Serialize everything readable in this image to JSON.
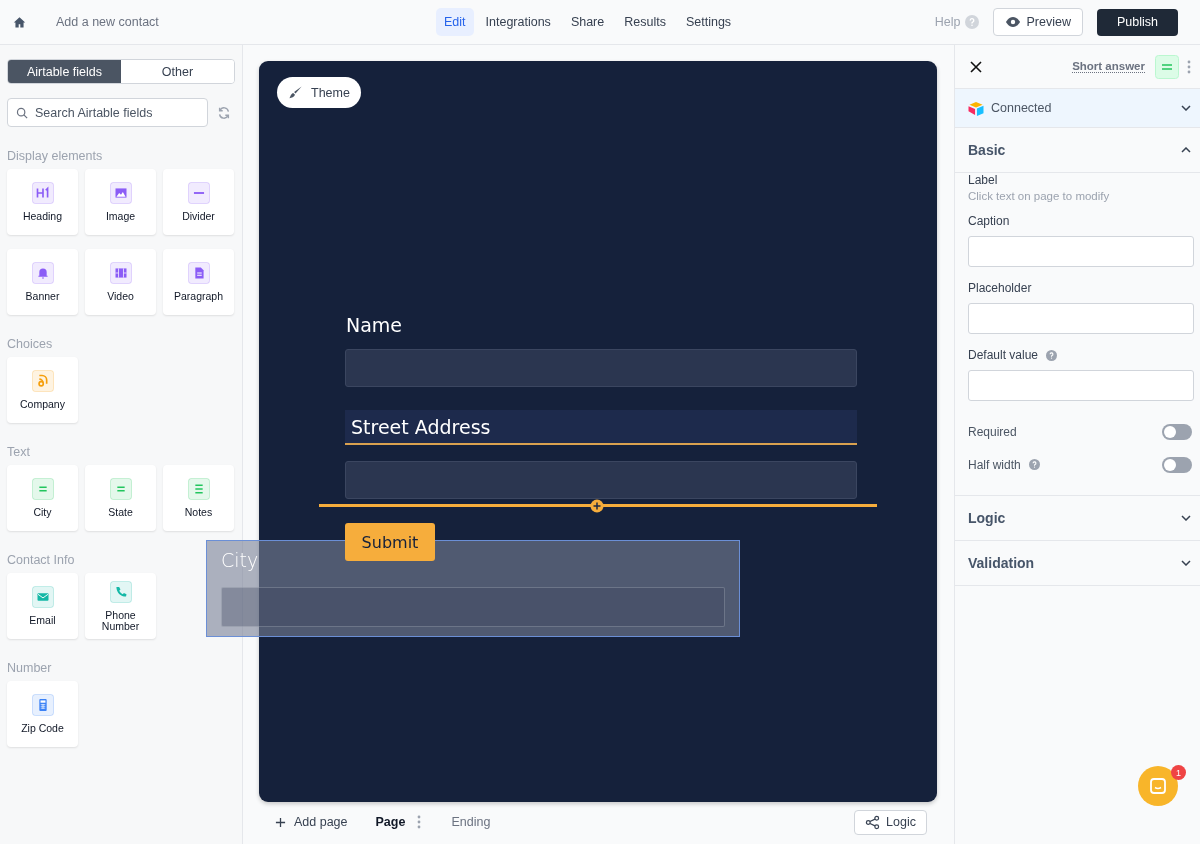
{
  "topbar": {
    "title": "Add a new contact",
    "tabs": [
      {
        "label": "Edit",
        "selected": true
      },
      {
        "label": "Integrations",
        "selected": false
      },
      {
        "label": "Share",
        "selected": false
      },
      {
        "label": "Results",
        "selected": false
      },
      {
        "label": "Settings",
        "selected": false
      }
    ],
    "help": "Help",
    "preview": "Preview",
    "publish": "Publish"
  },
  "sidebar": {
    "source_tabs": [
      {
        "label": "Airtable fields",
        "selected": true
      },
      {
        "label": "Other",
        "selected": false
      }
    ],
    "search": {
      "placeholder": "Search Airtable fields"
    },
    "groups": [
      {
        "title": "Display elements",
        "items": [
          {
            "label": "Heading",
            "kind": "heading",
            "color": "#8b5cf6"
          },
          {
            "label": "Image",
            "kind": "image",
            "color": "#8b5cf6"
          },
          {
            "label": "Divider",
            "kind": "divider",
            "color": "#8b5cf6"
          },
          {
            "label": "Banner",
            "kind": "banner",
            "color": "#8b5cf6"
          },
          {
            "label": "Video",
            "kind": "video",
            "color": "#8b5cf6"
          },
          {
            "label": "Paragraph",
            "kind": "paragraph",
            "color": "#8b5cf6"
          }
        ]
      },
      {
        "title": "Choices",
        "items": [
          {
            "label": "Company",
            "kind": "choice",
            "color": "#f59e0b"
          }
        ]
      },
      {
        "title": "Text",
        "items": [
          {
            "label": "City",
            "kind": "short",
            "color": "#22c55e"
          },
          {
            "label": "State",
            "kind": "short",
            "color": "#22c55e"
          },
          {
            "label": "Notes",
            "kind": "long",
            "color": "#22c55e"
          }
        ]
      },
      {
        "title": "Contact Info",
        "items": [
          {
            "label": "Email",
            "kind": "email",
            "color": "#14b8a6"
          },
          {
            "label": "Phone Number",
            "kind": "phone",
            "color": "#14b8a6"
          }
        ]
      },
      {
        "title": "Number",
        "items": [
          {
            "label": "Zip Code",
            "kind": "number",
            "color": "#3b82f6"
          }
        ]
      }
    ]
  },
  "canvas": {
    "theme": "Theme",
    "fields": [
      {
        "label": "Name",
        "highlighted": false
      },
      {
        "label": "Street Address",
        "highlighted": true
      }
    ],
    "submit": "Submit",
    "dragged_field": {
      "label": "City"
    }
  },
  "pages_bar": {
    "add_page": "Add page",
    "pages": [
      {
        "label": "Page",
        "selected": true
      },
      {
        "label": "Ending",
        "selected": false
      }
    ],
    "logic": "Logic"
  },
  "inspector": {
    "field_type": "Short answer",
    "connection": "Connected",
    "sections": [
      {
        "title": "Basic",
        "expanded": true
      },
      {
        "title": "Logic",
        "expanded": false
      },
      {
        "title": "Validation",
        "expanded": false
      }
    ],
    "label": {
      "title": "Label",
      "hint": "Click text on page to modify"
    },
    "inputs": [
      {
        "label": "Caption",
        "help": false
      },
      {
        "label": "Placeholder",
        "help": false
      },
      {
        "label": "Default value",
        "help": true
      }
    ],
    "toggles": [
      {
        "label": "Required",
        "on": false,
        "help": false
      },
      {
        "label": "Half width",
        "on": false,
        "help": true
      }
    ]
  },
  "chat": {
    "badge": "1"
  }
}
